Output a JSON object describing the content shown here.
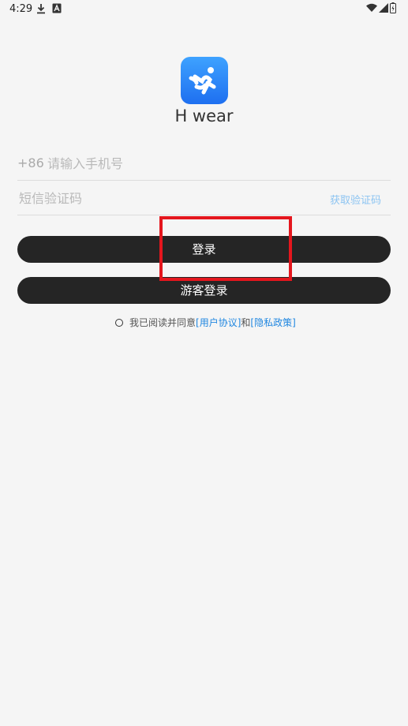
{
  "status_bar": {
    "time": "4:29"
  },
  "app": {
    "name": "H wear"
  },
  "phone": {
    "country_code": "+86",
    "placeholder": "请输入手机号",
    "value": ""
  },
  "code": {
    "placeholder": "短信验证码",
    "value": "",
    "get_code_label": "获取验证码"
  },
  "buttons": {
    "login": "登录",
    "guest_login": "游客登录"
  },
  "agreement": {
    "prefix": "我已阅读并同意",
    "user_agreement": "[用户协议]",
    "and": "和",
    "privacy_policy": "[隐私政策]"
  },
  "colors": {
    "background": "#f5f5f5",
    "button": "#252525",
    "link": "#1f86e0",
    "highlight": "#e4161d"
  }
}
